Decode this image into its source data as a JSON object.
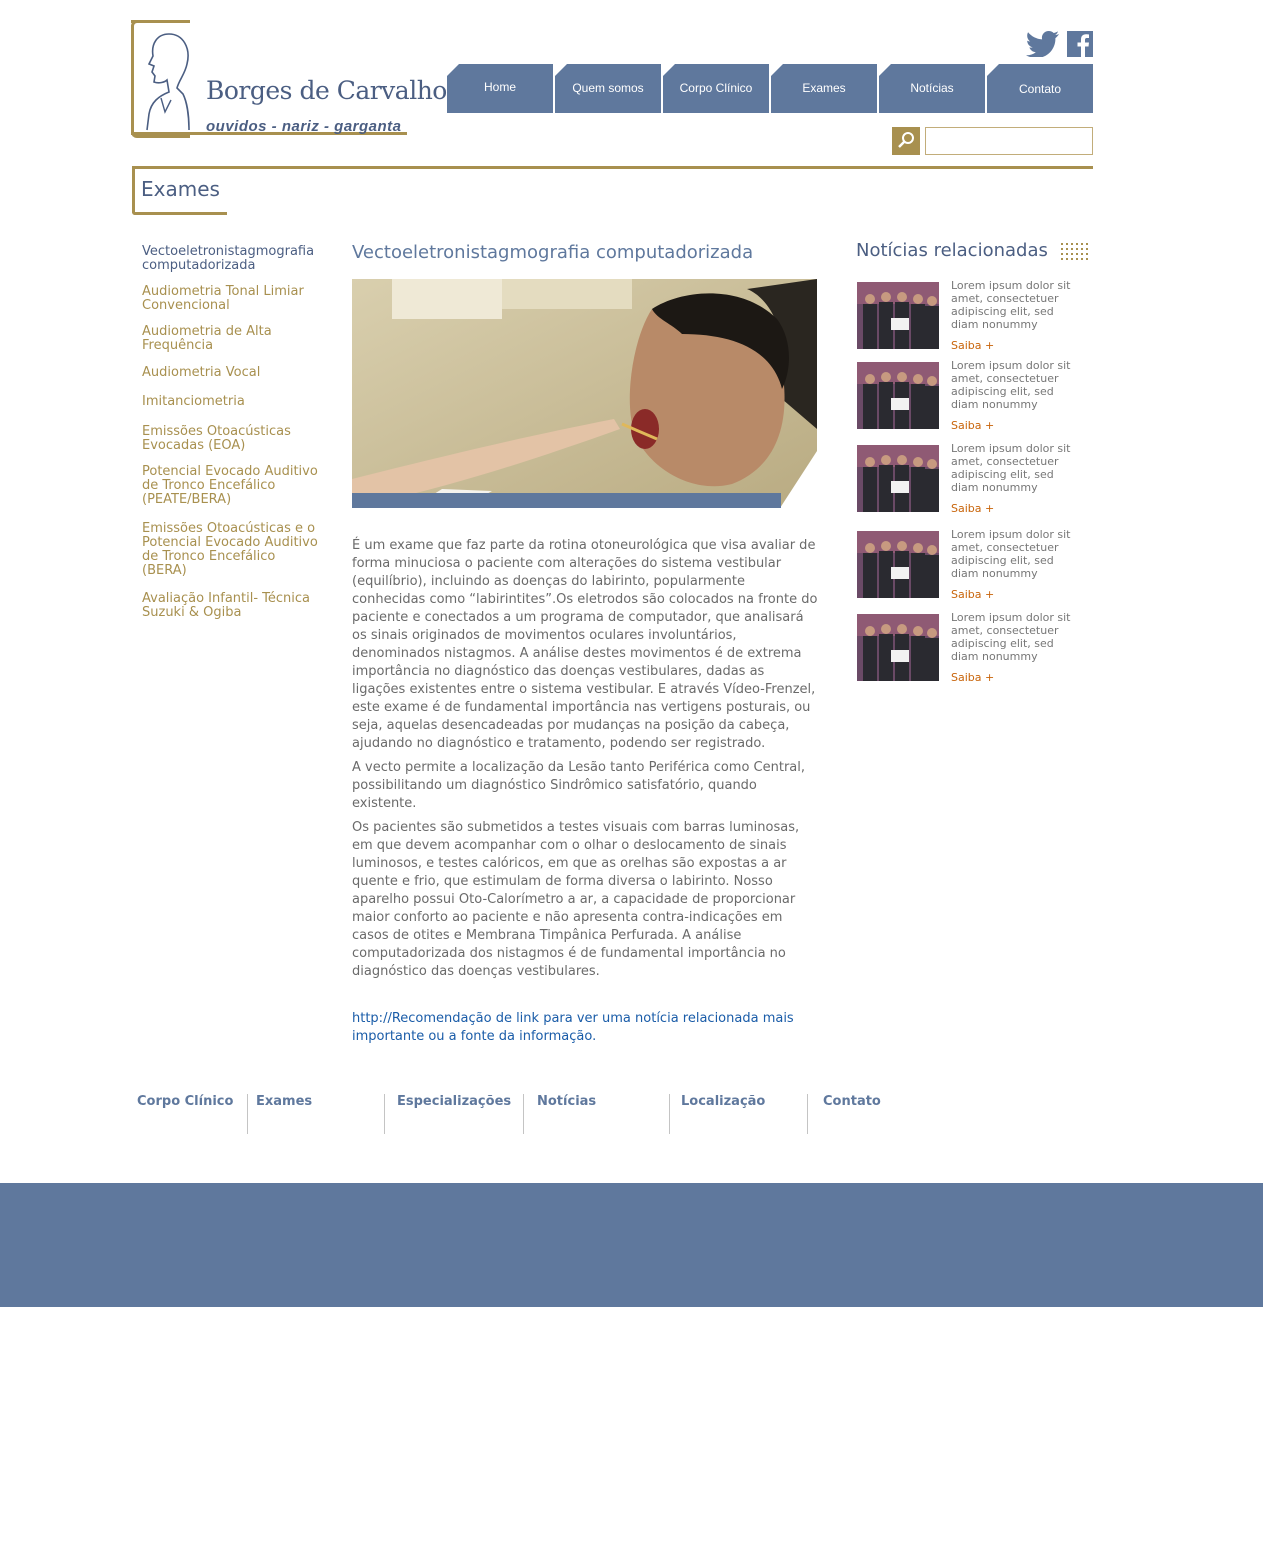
{
  "brand": {
    "name": "Borges de Carvalho",
    "tagline": "ouvidos - nariz - garganta",
    "color_gold": "#a8904f",
    "color_blue": "#5f789d"
  },
  "social": {
    "twitter_icon": "twitter-icon",
    "facebook_icon": "facebook-icon"
  },
  "nav": {
    "items": [
      {
        "label": "Home"
      },
      {
        "label": "Quem somos"
      },
      {
        "label": "Corpo Clínico"
      },
      {
        "label": "Exames"
      },
      {
        "label": "Notícias"
      },
      {
        "label": "Contato"
      }
    ]
  },
  "search": {
    "value": ""
  },
  "section": {
    "title": "Exames"
  },
  "left_menu": {
    "items": [
      {
        "label": "Vectoeletronistagmografia computadorizada",
        "active": true
      },
      {
        "label": "Audiometria Tonal Limiar Convencional"
      },
      {
        "label": "Audiometria de Alta Frequência"
      },
      {
        "label": "Audiometria Vocal"
      },
      {
        "label": "Imitanciometria"
      },
      {
        "label": "Emissões Otoacústicas Evocadas (EOA)"
      },
      {
        "label": "Potencial Evocado Auditivo de Tronco Encefálico (PEATE/BERA)"
      },
      {
        "label": "Emissões Otoacústicas e o Potencial Evocado Auditivo de Tronco Encefálico (BERA)"
      },
      {
        "label": "Avaliação Infantil- Técnica Suzuki & Ogiba"
      }
    ]
  },
  "main": {
    "title": "Vectoeletronistagmografia computadorizada",
    "paragraphs": [
      "É um exame que faz parte da rotina otoneurológica que visa avaliar de forma minuciosa o paciente com alterações do sistema vestibular (equilíbrio), incluindo as doenças do labirinto, popularmente conhecidas como “labirintites”.Os eletrodos são colocados na fronte do paciente e conectados a um programa de computador, que analisará os sinais originados de movimentos oculares involuntários, denominados nistagmos. A análise destes movimentos é de extrema importância no diagnóstico das doenças vestibulares, dadas as ligações existentes entre o sistema vestibular. E através Vídeo-Frenzel, este exame é de fundamental importância nas vertigens posturais, ou seja, aquelas desencadeadas por mudanças na posição da cabeça, ajudando no diagnóstico e tratamento, podendo ser registrado.",
      "A vecto permite a localização da Lesão tanto Periférica como Central, possibilitando um diagnóstico Sindrômico satisfatório, quando existente.",
      "Os pacientes são submetidos a testes visuais com barras luminosas, em que devem acompanhar com o olhar o deslocamento de sinais luminosos, e testes calóricos, em que as orelhas são expostas a ar quente e frio, que estimulam de forma diversa o labirinto. Nosso aparelho possui Oto-Calorímetro a ar, a capacidade de proporcionar maior conforto ao paciente e não apresenta contra-indicações em casos de otites e Membrana Timpânica Perfurada. A análise computadorizada dos nistagmos é de fundamental importância no diagnóstico das doenças vestibulares."
    ],
    "link": "http://Recomendação de link para ver uma notícia relacionada mais importante ou a fonte da informação."
  },
  "related": {
    "title": "Notícias relacionadas",
    "items": [
      {
        "text": "Lorem ipsum dolor sit amet, consectetuer adipiscing elit, sed diam nonummy",
        "more": "Saiba +"
      },
      {
        "text": "Lorem ipsum dolor sit amet, consectetuer adipiscing elit, sed diam nonummy",
        "more": "Saiba +"
      },
      {
        "text": "Lorem ipsum dolor sit amet, consectetuer adipiscing elit, sed diam nonummy",
        "more": "Saiba +"
      },
      {
        "text": "Lorem ipsum dolor sit amet, consectetuer adipiscing elit, sed diam nonummy",
        "more": "Saiba +"
      },
      {
        "text": "Lorem ipsum dolor sit amet, consectetuer adipiscing elit, sed diam nonummy",
        "more": "Saiba +"
      }
    ]
  },
  "footer": {
    "links": [
      "Corpo Clínico",
      "Exames",
      "Especializações",
      "Notícias",
      "Localização",
      "Contato"
    ]
  }
}
